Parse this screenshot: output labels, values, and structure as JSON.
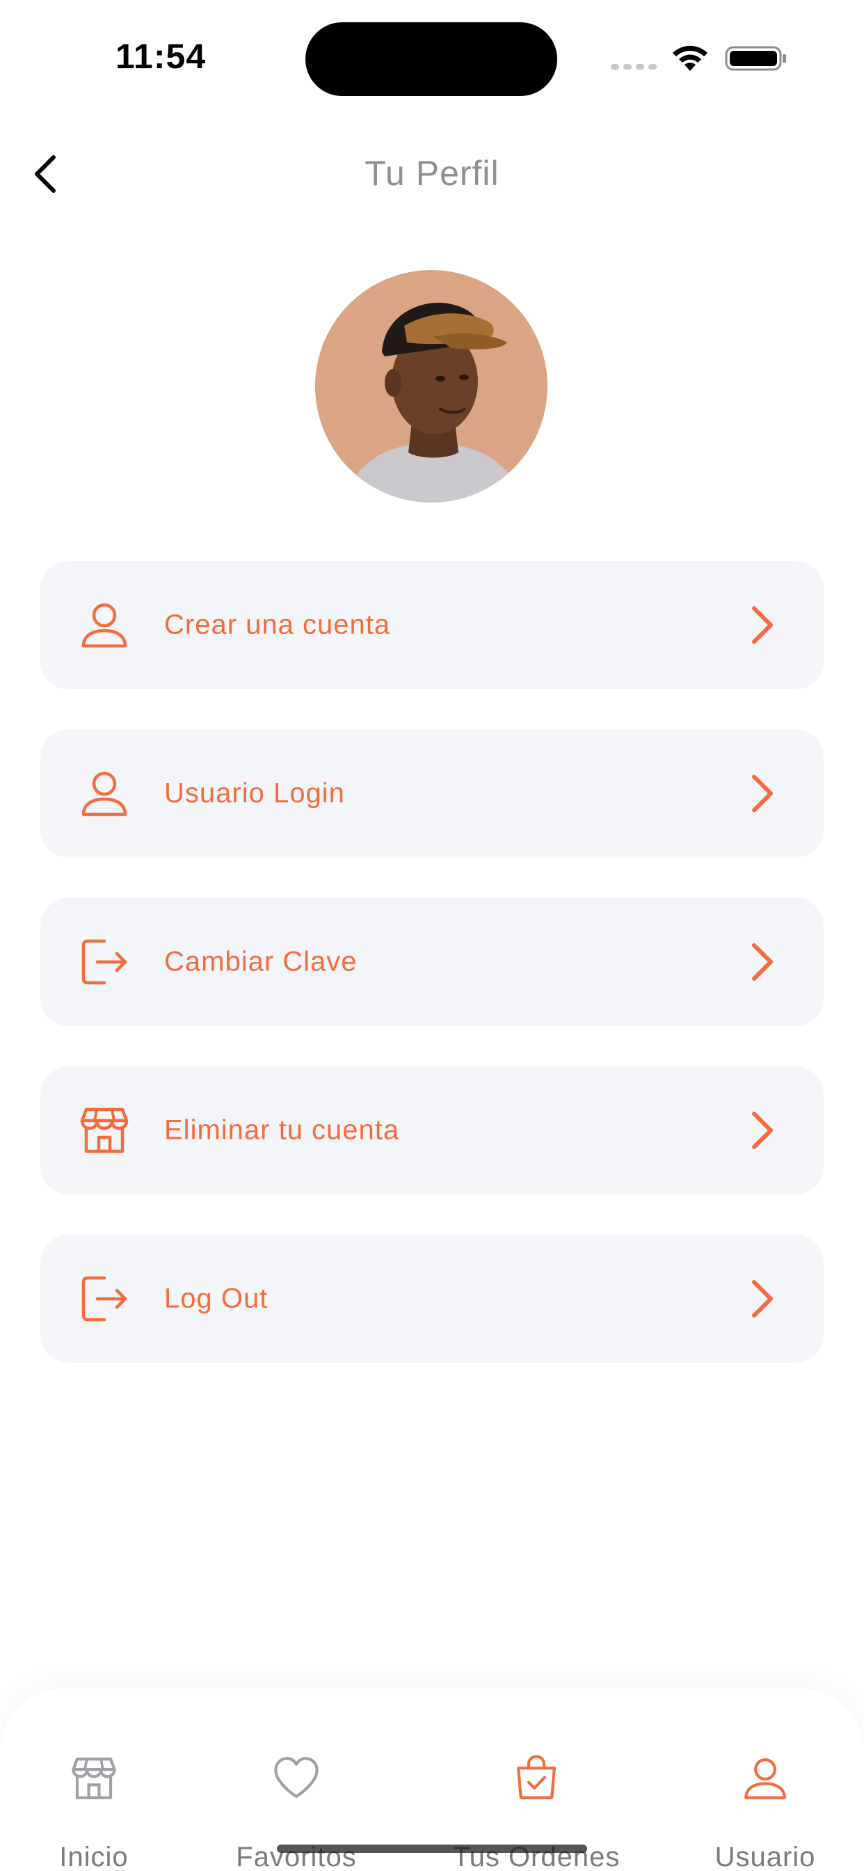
{
  "status_bar": {
    "time": "11:54"
  },
  "header": {
    "title": "Tu Perfil",
    "back_icon": "chevron-left-icon"
  },
  "profile": {
    "avatar_icon": "user-photo"
  },
  "menu": [
    {
      "label": "Crear una cuenta",
      "icon": "user-icon"
    },
    {
      "label": "Usuario Login",
      "icon": "user-icon"
    },
    {
      "label": "Cambiar Clave",
      "icon": "logout-icon"
    },
    {
      "label": "Eliminar tu cuenta",
      "icon": "store-icon"
    },
    {
      "label": "Log Out",
      "icon": "logout-icon"
    }
  ],
  "tabs": [
    {
      "label": "Inicio",
      "icon": "store-icon",
      "active": false
    },
    {
      "label": "Favoritos",
      "icon": "heart-icon",
      "active": false
    },
    {
      "label": "Tus Ordenes",
      "icon": "bag-check-icon",
      "active": true
    },
    {
      "label": "Usuario",
      "icon": "user-icon",
      "active": true
    }
  ],
  "colors": {
    "accent": "#F26C3D",
    "card_bg": "#F4F5F9",
    "muted_text": "#8E8E93",
    "tab_inactive": "#A0A0A6"
  }
}
